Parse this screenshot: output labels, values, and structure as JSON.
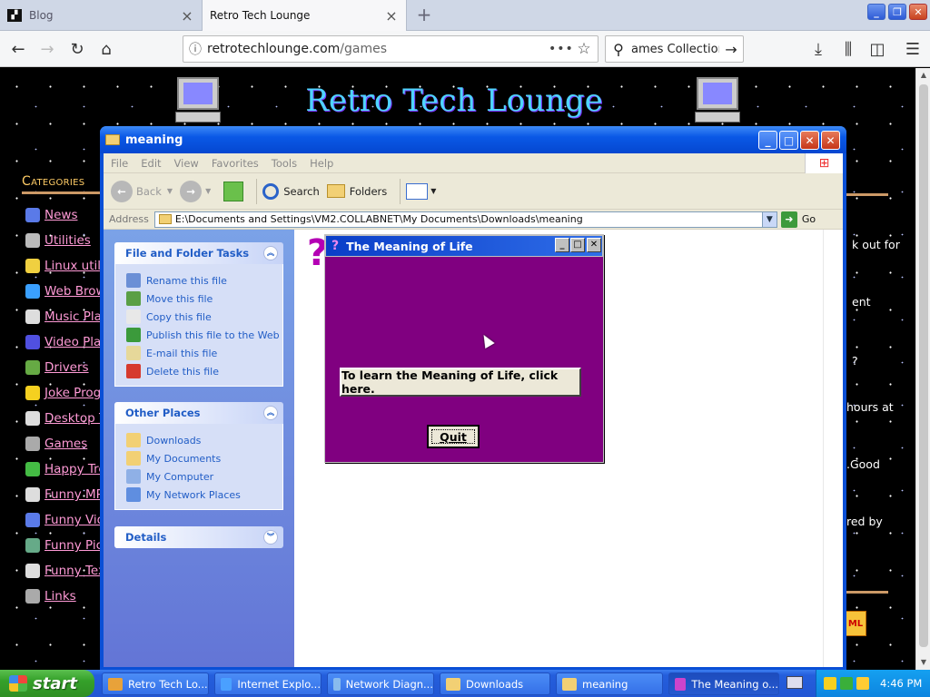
{
  "browser": {
    "tabs": [
      {
        "label": "Blog",
        "active": false
      },
      {
        "label": "Retro Tech Lounge",
        "active": true
      }
    ],
    "url_domain": "retrotechlounge.com",
    "url_path": "/games",
    "search_text": "ames Collection"
  },
  "page": {
    "site_title": "Retro Tech Lounge",
    "categories_heading": "Categories",
    "categories": [
      {
        "label": "News",
        "icon_color": "#5a7ae8"
      },
      {
        "label": "Utilities",
        "icon_color": "#bbbbbb"
      },
      {
        "label": "Linux utils",
        "icon_color": "#f0d040"
      },
      {
        "label": "Web Brow",
        "icon_color": "#3aa0ff"
      },
      {
        "label": "Music Play",
        "icon_color": "#dddddd"
      },
      {
        "label": "Video Play",
        "icon_color": "#5050e0"
      },
      {
        "label": "Drivers",
        "icon_color": "#66aa44"
      },
      {
        "label": "Joke Progr",
        "icon_color": "#f5d020"
      },
      {
        "label": "Desktop To",
        "icon_color": "#dddddd"
      },
      {
        "label": "Games",
        "icon_color": "#aaaaaa"
      },
      {
        "label": "Happy Tree",
        "icon_color": "#44bb44"
      },
      {
        "label": "Funny MP",
        "icon_color": "#dddddd"
      },
      {
        "label": "Funny Vide",
        "icon_color": "#5a7ae8"
      },
      {
        "label": "Funny Pict",
        "icon_color": "#66aa88"
      },
      {
        "label": "Funny Tex",
        "icon_color": "#dddddd"
      },
      {
        "label": "Links",
        "icon_color": "#aaaaaa"
      }
    ],
    "right_snippets": [
      "k out for",
      "ent",
      "?",
      "hours at",
      ".Good",
      "red by"
    ],
    "xml_badge": "ML"
  },
  "explorer": {
    "title": "meaning",
    "menu": [
      "File",
      "Edit",
      "View",
      "Favorites",
      "Tools",
      "Help"
    ],
    "toolbar": {
      "back": "Back",
      "search": "Search",
      "folders": "Folders"
    },
    "address_label": "Address",
    "address_value": "E:\\Documents and Settings\\VM2.COLLABNET\\My Documents\\Downloads\\meaning",
    "go_label": "Go",
    "file_tasks": {
      "heading": "File and Folder Tasks",
      "items": [
        {
          "label": "Rename this file",
          "icon_color": "#6b8fd6"
        },
        {
          "label": "Move this file",
          "icon_color": "#5a9f45"
        },
        {
          "label": "Copy this file",
          "icon_color": "#e8e8e8"
        },
        {
          "label": "Publish this file to the Web",
          "icon_color": "#3b9a3b"
        },
        {
          "label": "E-mail this file",
          "icon_color": "#e6d89a"
        },
        {
          "label": "Delete this file",
          "icon_color": "#d63a2e"
        }
      ]
    },
    "other_places": {
      "heading": "Other Places",
      "items": [
        {
          "label": "Downloads",
          "icon_color": "#f2d074"
        },
        {
          "label": "My Documents",
          "icon_color": "#f2d074"
        },
        {
          "label": "My Computer",
          "icon_color": "#8fb0e6"
        },
        {
          "label": "My Network Places",
          "icon_color": "#5f8ee0"
        }
      ]
    },
    "details": {
      "heading": "Details"
    }
  },
  "dialog": {
    "title": "The Meaning of Life",
    "learn_button": "To learn the Meaning of Life, click here.",
    "quit_button": "Quit",
    "background_color": "#800080"
  },
  "taskbar": {
    "start_label": "start",
    "tasks": [
      {
        "label": "Retro Tech Lo...",
        "icon_color": "#e8a23a"
      },
      {
        "label": "Internet Explo...",
        "icon_color": "#4aa0ff"
      },
      {
        "label": "Network Diagn...",
        "icon_color": "#88bbee"
      },
      {
        "label": "Downloads",
        "icon_color": "#f2d074"
      },
      {
        "label": "meaning",
        "icon_color": "#f2d074"
      },
      {
        "label": "The Meaning o...",
        "icon_color": "#cc44cc"
      }
    ],
    "clock": "4:46 PM"
  }
}
